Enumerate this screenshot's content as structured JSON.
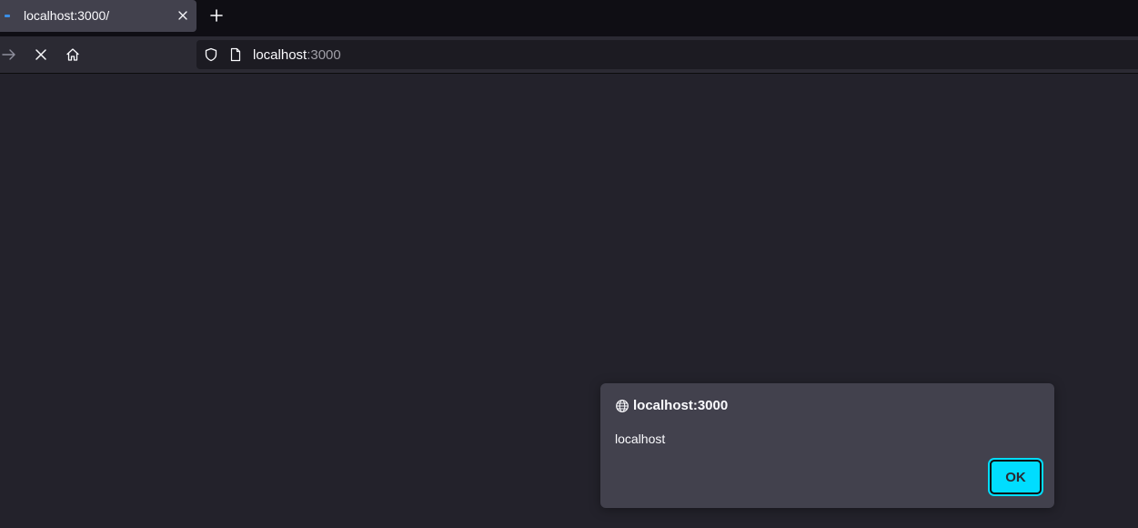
{
  "tab": {
    "title": "localhost:3000/",
    "close_icon": "close-icon",
    "loading_icon": "loading-throbber-icon"
  },
  "new_tab_icon": "plus-icon",
  "toolbar": {
    "forward_icon": "arrow-right-icon",
    "stop_icon": "close-icon",
    "home_icon": "home-icon"
  },
  "urlbar": {
    "shield_icon": "shield-icon",
    "page_icon": "page-icon",
    "host": "localhost",
    "port": ":3000"
  },
  "dialog": {
    "title": "localhost:3000",
    "globe_icon": "globe-icon",
    "message": "localhost",
    "ok_label": "OK"
  },
  "colors": {
    "accent": "#00ddff",
    "tab_throbber": "#3a8ee6",
    "content_bg": "#23222b",
    "dialog_bg": "#42414d"
  }
}
